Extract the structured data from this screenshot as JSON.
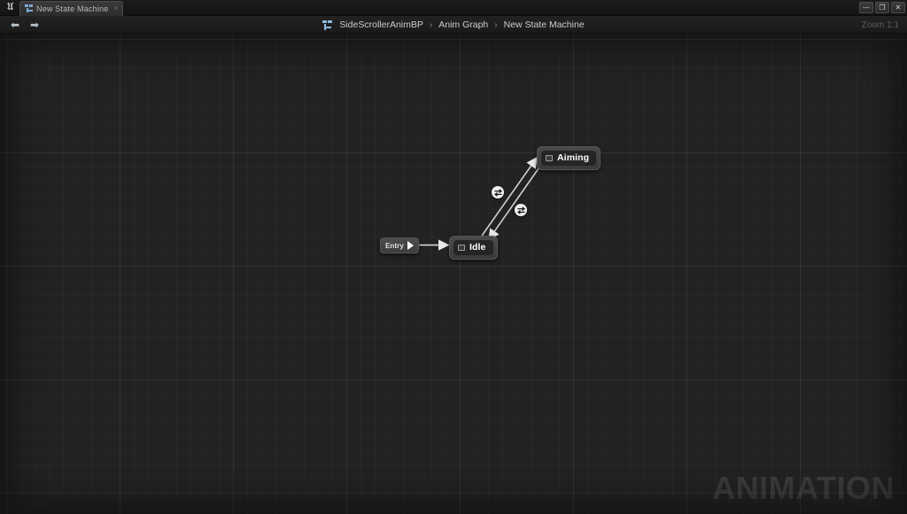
{
  "window": {
    "app_logo": "unreal-engine-logo",
    "tab": {
      "label": "New State Machine",
      "close_glyph": "×",
      "icon": "state-machine-icon"
    },
    "controls": {
      "minimize": "—",
      "maximize": "❐",
      "close": "✕"
    }
  },
  "toolbar": {
    "back_glyph": "⬅",
    "forward_glyph": "➡",
    "breadcrumb": {
      "icon": "anim-graph-icon",
      "separator": "›",
      "items": [
        {
          "label": "SideScrollerAnimBP"
        },
        {
          "label": "Anim Graph"
        },
        {
          "label": "New State Machine"
        }
      ]
    },
    "zoom_label": "Zoom 1:1"
  },
  "graph": {
    "entry": {
      "label": "Entry"
    },
    "states": [
      {
        "label": "Aiming"
      },
      {
        "label": "Idle"
      }
    ],
    "transitions": [
      {
        "name": "idle-to-aiming",
        "badge": "transition-rule-icon"
      },
      {
        "name": "aiming-to-idle",
        "badge": "transition-rule-icon"
      }
    ],
    "watermark": "ANIMATION"
  }
}
